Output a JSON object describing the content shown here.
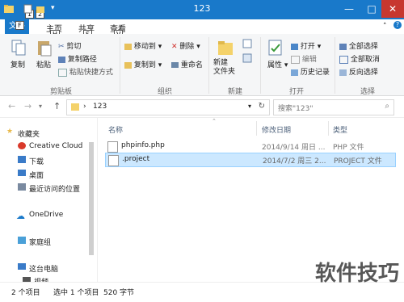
{
  "window": {
    "title": "123"
  },
  "qa_badges": [
    "1",
    "2"
  ],
  "ribbon_tabs": [
    {
      "label": "文件",
      "key": "F"
    },
    {
      "label": "主页",
      "key": "H"
    },
    {
      "label": "共享",
      "key": "S"
    },
    {
      "label": "查看",
      "key": "V"
    }
  ],
  "ribbon": {
    "groups": [
      "剪贴板",
      "组织",
      "新建",
      "打开",
      "选择"
    ],
    "copy": "复制",
    "paste": "粘贴",
    "cut": "剪切",
    "copy_path": "复制路径",
    "paste_shortcut": "粘贴快捷方式",
    "move_to": "移动到",
    "copy_to": "复制到",
    "delete": "删除",
    "rename": "重命名",
    "new_folder": "新建\n文件夹",
    "properties": "属性",
    "open": "打开",
    "edit": "编辑",
    "history": "历史记录",
    "select_all": "全部选择",
    "select_none": "全部取消",
    "invert": "反向选择"
  },
  "address": {
    "path": "123",
    "search_placeholder": "搜索\"123\""
  },
  "nav": {
    "items": [
      {
        "label": "收藏夹",
        "icon": "star-icon"
      },
      {
        "label": "Creative Cloud",
        "icon": "creative-cloud-icon"
      },
      {
        "label": "下载",
        "icon": "download-icon"
      },
      {
        "label": "桌面",
        "icon": "desktop-icon"
      },
      {
        "label": "最近访问的位置",
        "icon": "recent-icon"
      },
      {
        "label": "OneDrive",
        "icon": "onedrive-icon"
      },
      {
        "label": "家庭组",
        "icon": "homegroup-icon"
      },
      {
        "label": "这台电脑",
        "icon": "computer-icon"
      },
      {
        "label": "视频",
        "icon": "video-icon"
      }
    ]
  },
  "columns": {
    "name": "名称",
    "date": "修改日期",
    "type": "类型"
  },
  "files": [
    {
      "name": "phpinfo.php",
      "date": "2014/9/14 周日 ...",
      "type": "PHP 文件"
    },
    {
      "name": ".project",
      "date": "2014/7/2 周三 2...",
      "type": "PROJECT 文件"
    }
  ],
  "status": {
    "count": "2 个项目",
    "selected": "选中 1 个项目",
    "size": "520 字节"
  },
  "watermark": "软件技巧"
}
